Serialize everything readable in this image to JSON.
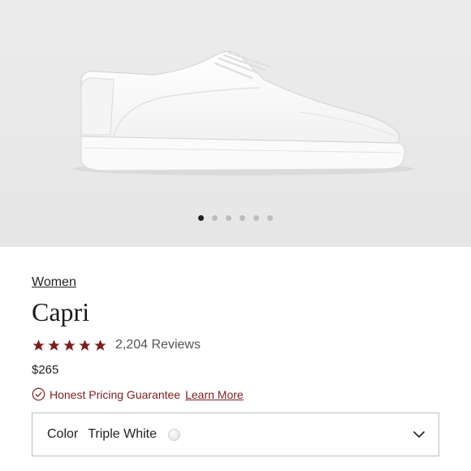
{
  "gallery": {
    "image_alt": "White leather low-top sneaker",
    "dots": 6,
    "active_dot": 0
  },
  "product": {
    "breadcrumb": "Women",
    "name": "Capri",
    "rating": 5,
    "reviews_label": "2,204 Reviews",
    "price": "$265"
  },
  "guarantee": {
    "text": "Honest Pricing Guarantee",
    "link": "Learn More"
  },
  "color_select": {
    "label": "Color",
    "value": "Triple White"
  },
  "colors": {
    "star": "#7a1f1f",
    "accent": "#7a1f1f"
  }
}
